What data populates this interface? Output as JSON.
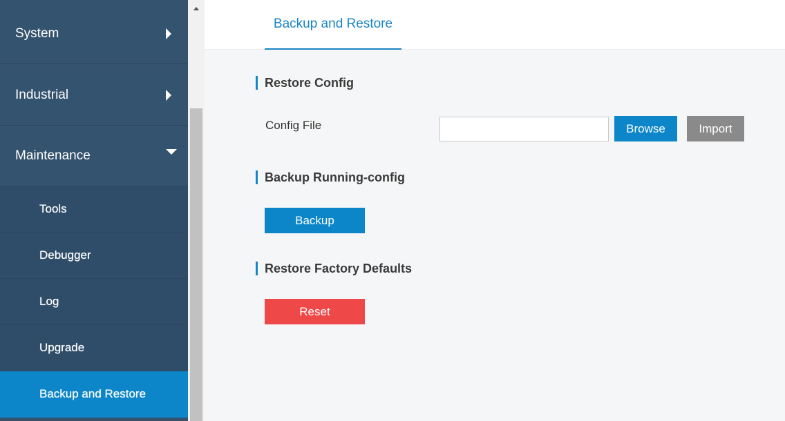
{
  "sidebar": {
    "items": [
      {
        "label": "System",
        "expanded": false
      },
      {
        "label": "Industrial",
        "expanded": false
      },
      {
        "label": "Maintenance",
        "expanded": true
      }
    ],
    "sub_items": [
      {
        "label": "Tools"
      },
      {
        "label": "Debugger"
      },
      {
        "label": "Log"
      },
      {
        "label": "Upgrade"
      },
      {
        "label": "Backup and Restore",
        "active": true
      }
    ]
  },
  "tabs": [
    {
      "label": "Backup and Restore",
      "active": true
    }
  ],
  "restore_config": {
    "title": "Restore Config",
    "field_label": "Config File",
    "file_value": "",
    "browse_label": "Browse",
    "import_label": "Import"
  },
  "backup_running": {
    "title": "Backup Running-config",
    "backup_label": "Backup"
  },
  "factory_defaults": {
    "title": "Restore Factory Defaults",
    "reset_label": "Reset"
  },
  "colors": {
    "sidebar_bg": "#34536f",
    "accent": "#0c86c9",
    "reset": "#ee4848",
    "import": "#8a8a8a"
  }
}
